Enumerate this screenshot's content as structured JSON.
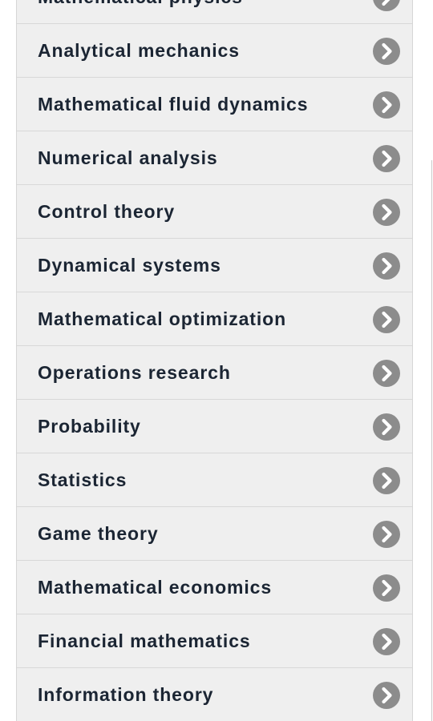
{
  "menu": {
    "items": [
      {
        "label": "Mathematical physics",
        "icon": "chevron-right-circle-icon"
      },
      {
        "label": "Analytical mechanics",
        "icon": "chevron-right-circle-icon"
      },
      {
        "label": "Mathematical fluid dynamics",
        "icon": "chevron-right-circle-icon"
      },
      {
        "label": "Numerical analysis",
        "icon": "chevron-right-circle-icon"
      },
      {
        "label": "Control theory",
        "icon": "chevron-right-circle-icon"
      },
      {
        "label": "Dynamical systems",
        "icon": "chevron-right-circle-icon"
      },
      {
        "label": "Mathematical optimization",
        "icon": "chevron-right-circle-icon"
      },
      {
        "label": "Operations research",
        "icon": "chevron-right-circle-icon"
      },
      {
        "label": "Probability",
        "icon": "chevron-right-circle-icon"
      },
      {
        "label": "Statistics",
        "icon": "chevron-right-circle-icon"
      },
      {
        "label": "Game theory",
        "icon": "chevron-right-circle-icon"
      },
      {
        "label": "Mathematical economics",
        "icon": "chevron-right-circle-icon"
      },
      {
        "label": "Financial mathematics",
        "icon": "chevron-right-circle-icon"
      },
      {
        "label": "Information theory",
        "icon": "chevron-right-circle-icon"
      }
    ]
  },
  "colors": {
    "item_background": "#efefef",
    "label_text": "#1b2533",
    "chevron_circle": "#8c8c8c",
    "chevron_arrow": "#ffffff",
    "divider": "#d8d8d8"
  }
}
